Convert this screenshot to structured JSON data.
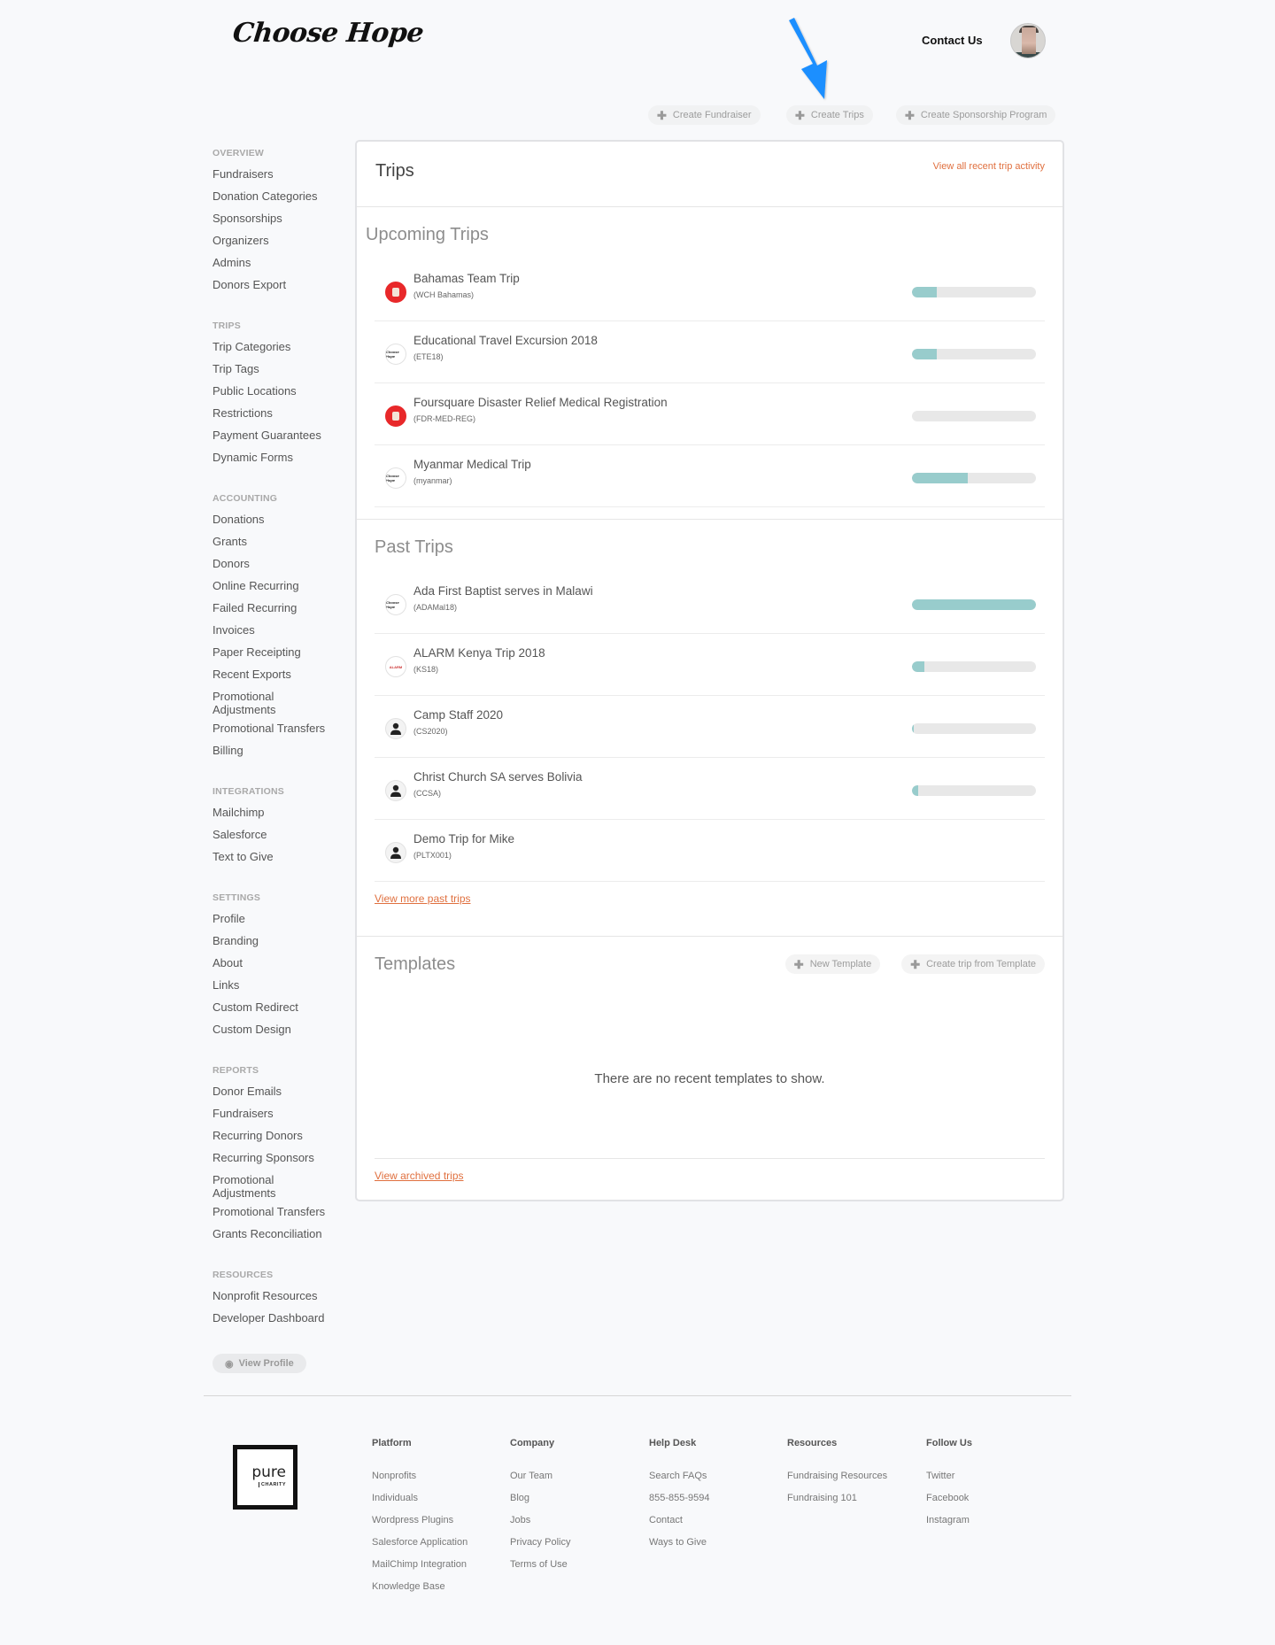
{
  "header": {
    "logo": "Choose Hope",
    "contact_label": "Contact Us",
    "avatar_alt": "User avatar"
  },
  "create_actions": [
    {
      "label": "Create Fundraiser"
    },
    {
      "label": "Create Trips"
    },
    {
      "label": "Create Sponsorship Program"
    }
  ],
  "sidebar": {
    "sections": [
      {
        "title": "OVERVIEW",
        "items": [
          "Fundraisers",
          "Donation Categories",
          "Sponsorships",
          "Organizers",
          "Admins",
          "Donors Export"
        ]
      },
      {
        "title": "TRIPS",
        "items": [
          "Trip Categories",
          "Trip Tags",
          "Public Locations",
          "Restrictions",
          "Payment Guarantees",
          "Dynamic Forms"
        ]
      },
      {
        "title": "ACCOUNTING",
        "items": [
          "Donations",
          "Grants",
          "Donors",
          "Online Recurring",
          "Failed Recurring",
          "Invoices",
          "Paper Receipting",
          "Recent Exports",
          "Promotional Adjustments",
          "Promotional Transfers",
          "Billing"
        ]
      },
      {
        "title": "INTEGRATIONS",
        "items": [
          "Mailchimp",
          "Salesforce",
          "Text to Give"
        ]
      },
      {
        "title": "SETTINGS",
        "items": [
          "Profile",
          "Branding",
          "About",
          "Links",
          "Custom Redirect",
          "Custom Design"
        ]
      },
      {
        "title": "REPORTS",
        "items": [
          "Donor Emails",
          "Fundraisers",
          "Recurring Donors",
          "Recurring Sponsors",
          "Promotional Adjustments",
          "Promotional Transfers",
          "Grants Reconciliation"
        ]
      },
      {
        "title": "RESOURCES",
        "items": [
          "Nonprofit Resources",
          "Developer Dashboard"
        ]
      }
    ],
    "view_profile_label": "View Profile"
  },
  "main": {
    "title": "Trips",
    "activity_link": "View all recent trip activity",
    "upcoming": {
      "heading": "Upcoming Trips",
      "trips": [
        {
          "name": "Bahamas Team Trip",
          "code": "(WCH Bahamas)",
          "logo": "red",
          "progress": 0.2
        },
        {
          "name": "Educational Travel Excursion 2018",
          "code": "(ETE18)",
          "logo": "choose-hope",
          "progress": 0.2
        },
        {
          "name": "Foursquare Disaster Relief Medical Registration",
          "code": "(FDR-MED-REG)",
          "logo": "red",
          "progress": 0.0
        },
        {
          "name": "Myanmar Medical Trip",
          "code": "(myanmar)",
          "logo": "choose-hope",
          "progress": 0.45
        }
      ]
    },
    "past": {
      "heading": "Past Trips",
      "trips": [
        {
          "name": "Ada First Baptist serves in Malawi",
          "code": "(ADAMal18)",
          "logo": "choose-hope",
          "progress": 1.0
        },
        {
          "name": "ALARM Kenya Trip 2018",
          "code": "(KS18)",
          "logo": "alarm",
          "progress": 0.1
        },
        {
          "name": "Camp Staff 2020",
          "code": "(CS2020)",
          "logo": "person",
          "progress": 0.01
        },
        {
          "name": "Christ Church SA serves Bolivia",
          "code": "(CCSA)",
          "logo": "person",
          "progress": 0.05
        },
        {
          "name": "Demo Trip for Mike",
          "code": "(PLTX001)",
          "logo": "person",
          "progress": null
        }
      ],
      "view_more": "View more past trips"
    },
    "templates": {
      "heading": "Templates",
      "new_template": "New Template",
      "create_from_template": "Create trip from Template",
      "empty": "There are no recent templates to show.",
      "archived_link": "View archived trips"
    }
  },
  "footer": {
    "logo_word": "pure",
    "logo_sub": "CHARITY",
    "columns": [
      {
        "title": "Platform",
        "links": [
          "Nonprofits",
          "Individuals",
          "Wordpress Plugins",
          "Salesforce Application",
          "MailChimp Integration",
          "Knowledge Base"
        ]
      },
      {
        "title": "Company",
        "links": [
          "Our Team",
          "Blog",
          "Jobs",
          "Privacy Policy",
          "Terms of Use"
        ]
      },
      {
        "title": "Help Desk",
        "links": [
          "Search FAQs",
          "855-855-9594",
          "Contact",
          "Ways to Give"
        ]
      },
      {
        "title": "Resources",
        "links": [
          "Fundraising Resources",
          "Fundraising 101"
        ]
      },
      {
        "title": "Follow Us",
        "links": [
          "Twitter",
          "Facebook",
          "Instagram"
        ]
      }
    ]
  },
  "colors": {
    "accent_link": "#e0703f",
    "progress_fill": "#98cccc",
    "progress_track": "#e8e8e8",
    "annotation_arrow": "#1e8fff"
  }
}
